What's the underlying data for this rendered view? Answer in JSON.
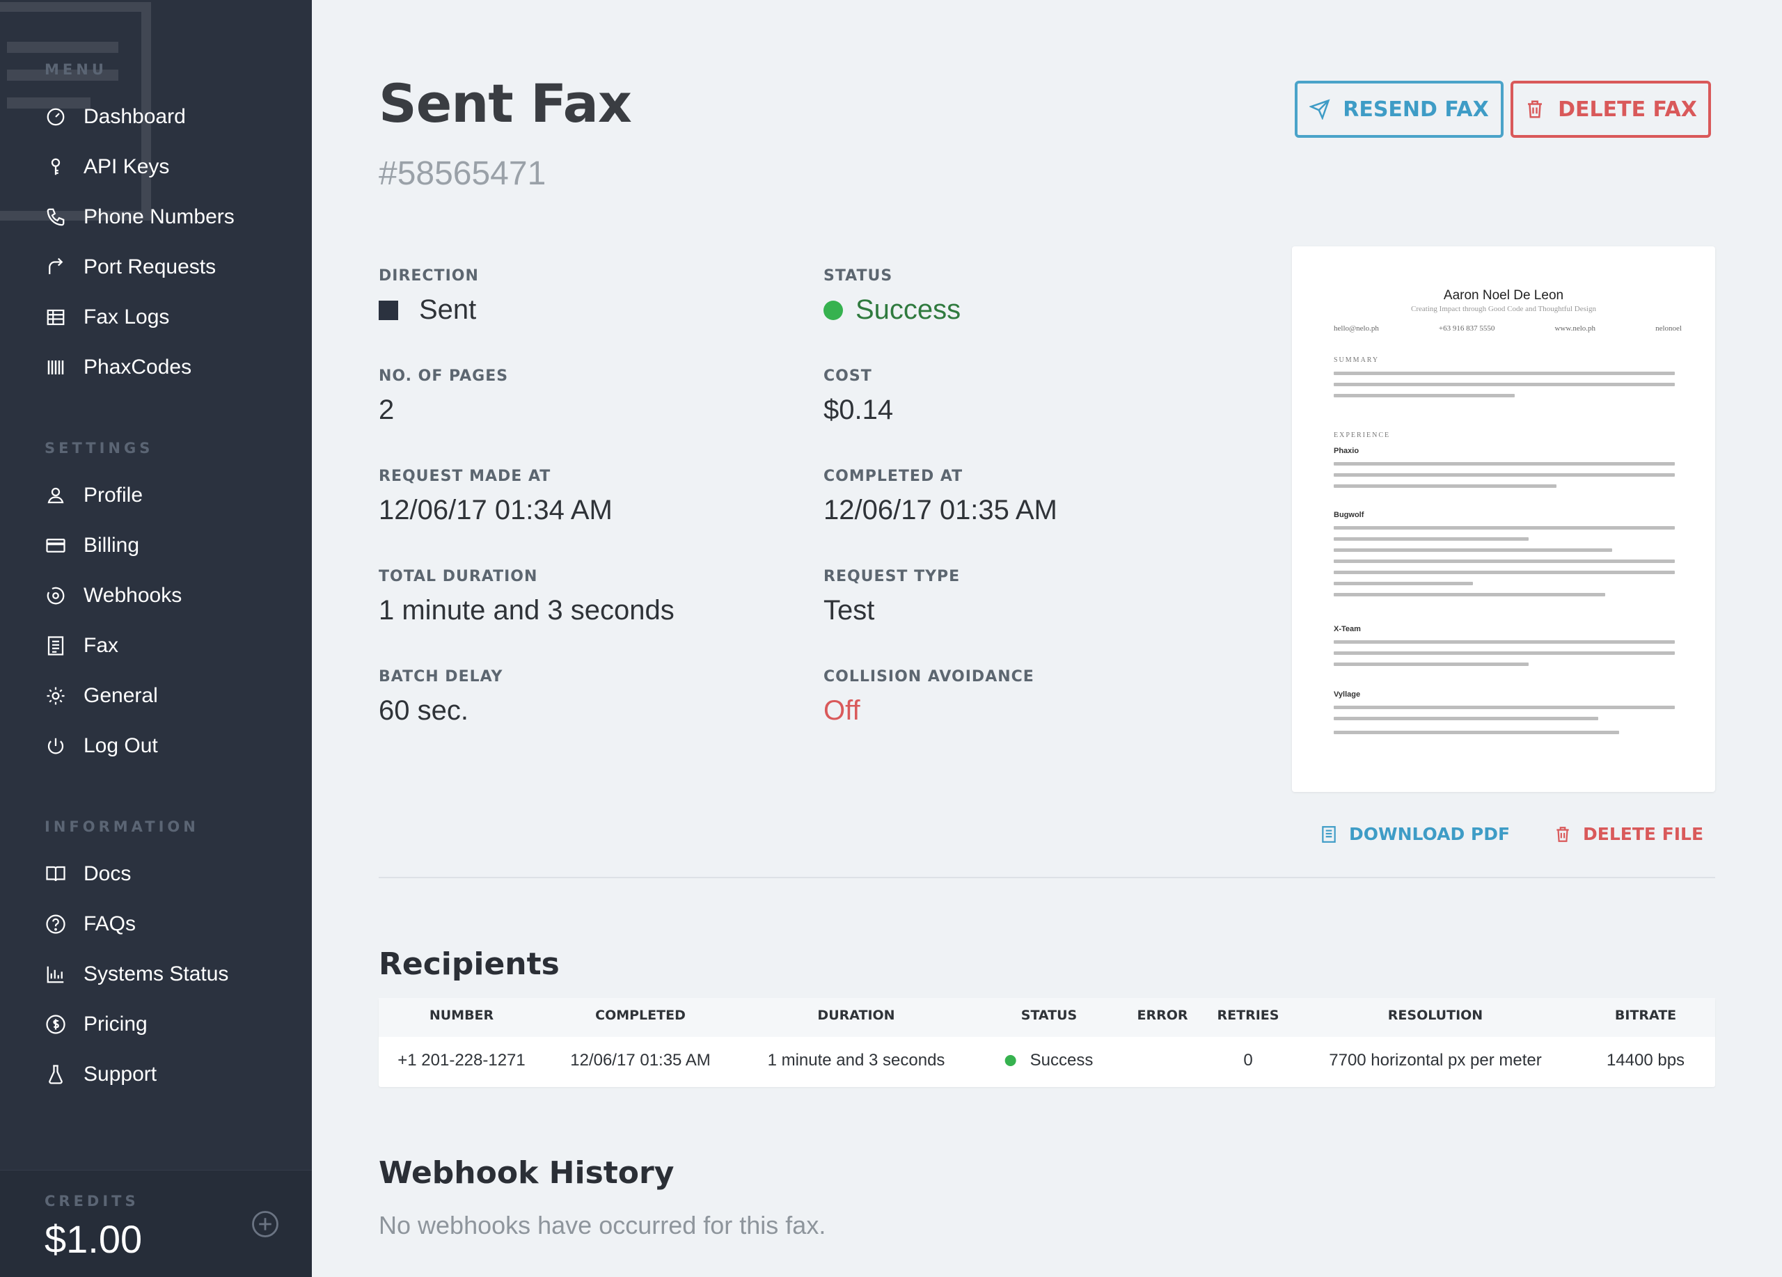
{
  "sidebar": {
    "menu_title": "MENU",
    "menu_items": [
      {
        "label": "Dashboard",
        "icon": "dashboard-icon"
      },
      {
        "label": "API Keys",
        "icon": "key-icon"
      },
      {
        "label": "Phone Numbers",
        "icon": "phone-icon"
      },
      {
        "label": "Port Requests",
        "icon": "port-icon"
      },
      {
        "label": "Fax Logs",
        "icon": "table-icon"
      },
      {
        "label": "PhaxCodes",
        "icon": "barcode-icon"
      }
    ],
    "settings_title": "SETTINGS",
    "settings_items": [
      {
        "label": "Profile",
        "icon": "user-icon"
      },
      {
        "label": "Billing",
        "icon": "credit-card-icon"
      },
      {
        "label": "Webhooks",
        "icon": "webhook-icon"
      },
      {
        "label": "Fax",
        "icon": "document-icon"
      },
      {
        "label": "General",
        "icon": "gear-icon"
      },
      {
        "label": "Log Out",
        "icon": "power-icon"
      }
    ],
    "information_title": "INFORMATION",
    "information_items": [
      {
        "label": "Docs",
        "icon": "book-icon"
      },
      {
        "label": "FAQs",
        "icon": "question-icon"
      },
      {
        "label": "Systems Status",
        "icon": "bar-chart-icon"
      },
      {
        "label": "Pricing",
        "icon": "dollar-icon"
      },
      {
        "label": "Support",
        "icon": "flask-icon"
      }
    ],
    "credits_label": "CREDITS",
    "credits_value": "$1.00"
  },
  "header": {
    "title": "Sent Fax",
    "fax_id": "#58565471",
    "resend_label": "RESEND FAX",
    "delete_label": "DELETE FAX"
  },
  "details": {
    "direction_label": "DIRECTION",
    "direction_value": "Sent",
    "status_label": "STATUS",
    "status_value": "Success",
    "pages_label": "NO. OF PAGES",
    "pages_value": "2",
    "cost_label": "COST",
    "cost_value": "$0.14",
    "request_made_label": "REQUEST MADE AT",
    "request_made_value": "12/06/17 01:34 AM",
    "completed_label": "COMPLETED AT",
    "completed_value": "12/06/17 01:35 AM",
    "duration_label": "TOTAL DURATION",
    "duration_value": "1 minute and 3 seconds",
    "request_type_label": "REQUEST TYPE",
    "request_type_value": "Test",
    "batch_delay_label": "BATCH DELAY",
    "batch_delay_value": "60 sec.",
    "collision_label": "COLLISION AVOIDANCE",
    "collision_value": "Off"
  },
  "preview": {
    "name": "Aaron Noel De Leon",
    "tagline": "Creating Impact through Good Code and Thoughtful Design",
    "contacts": [
      "hello@nelo.ph",
      "+63 916 837 5550",
      "www.nelo.ph",
      "nelonoel"
    ],
    "summary_title": "SUMMARY",
    "experience_title": "EXPERIENCE",
    "jobs": [
      "Phaxio",
      "Bugwolf",
      "X-Team",
      "Vyllage"
    ],
    "download_label": "DOWNLOAD PDF",
    "delete_file_label": "DELETE FILE"
  },
  "recipients": {
    "title": "Recipients",
    "columns": [
      "NUMBER",
      "COMPLETED",
      "DURATION",
      "STATUS",
      "ERROR",
      "RETRIES",
      "RESOLUTION",
      "BITRATE"
    ],
    "rows": [
      {
        "number": "+1 201-228-1271",
        "completed": "12/06/17 01:35 AM",
        "duration": "1 minute and 3 seconds",
        "status": "Success",
        "error": "",
        "retries": "0",
        "resolution": "7700 horizontal px per meter",
        "bitrate": "14400 bps"
      }
    ]
  },
  "webhooks": {
    "title": "Webhook History",
    "empty_message": "No webhooks have occurred for this fax."
  },
  "colors": {
    "sidebar_bg": "#2b323f",
    "accent_blue": "#3e9cc6",
    "danger_red": "#d9595a",
    "success_green": "#36b24f"
  }
}
